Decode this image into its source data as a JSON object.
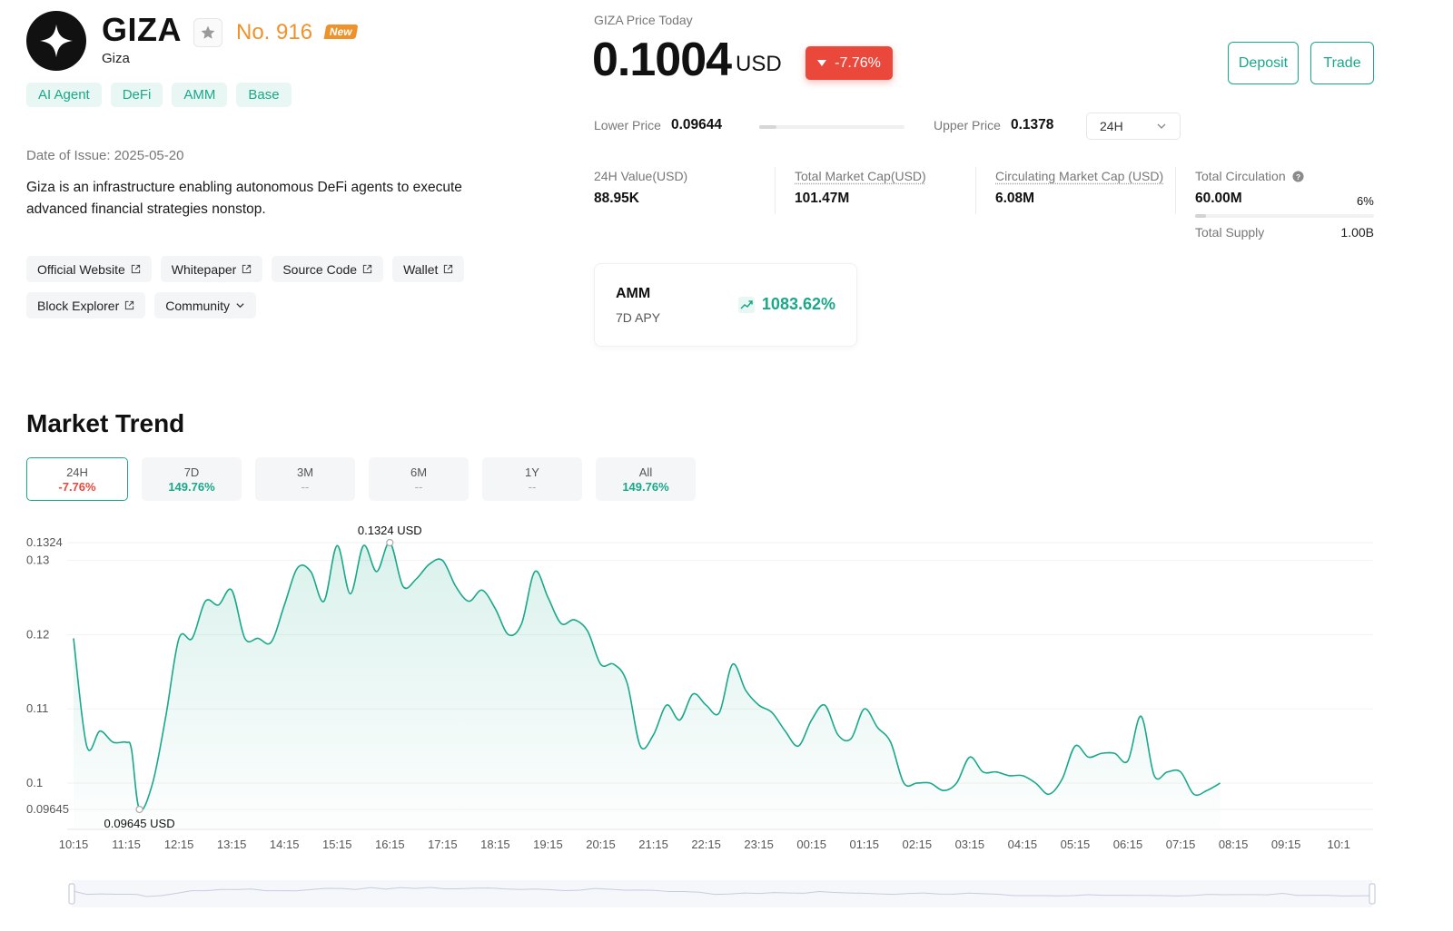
{
  "token": {
    "name": "GIZA",
    "subname": "Giza",
    "rank": "No. 916",
    "new_badge": "New",
    "tags": [
      "AI Agent",
      "DeFi",
      "AMM",
      "Base"
    ],
    "issue_date": "Date of Issue: 2025-05-20",
    "description": "Giza is an infrastructure enabling autonomous DeFi agents to execute advanced financial strategies nonstop.",
    "links": [
      {
        "label": "Official Website",
        "icon": "external-link-icon"
      },
      {
        "label": "Whitepaper",
        "icon": "external-link-icon"
      },
      {
        "label": "Source Code",
        "icon": "external-link-icon"
      },
      {
        "label": "Wallet",
        "icon": "external-link-icon"
      },
      {
        "label": "Block Explorer",
        "icon": "external-link-icon"
      },
      {
        "label": "Community",
        "icon": "chevron-down-icon"
      }
    ]
  },
  "price": {
    "label": "GIZA Price Today",
    "value": "0.1004",
    "unit": "USD",
    "change": "-7.76%",
    "lower_label": "Lower Price",
    "lower_value": "0.09644",
    "upper_label": "Upper Price",
    "upper_value": "0.1378",
    "period": "24H",
    "range_position": 0.12
  },
  "actions": {
    "deposit": "Deposit",
    "trade": "Trade"
  },
  "stats": {
    "value24h": {
      "label": "24H Value(USD)",
      "value": "88.95K"
    },
    "market_cap": {
      "label": "Total Market Cap(USD)",
      "value": "101.47M"
    },
    "circ_market_cap": {
      "label": "Circulating Market Cap (USD)",
      "value": "6.08M"
    },
    "total_circulation": {
      "label": "Total Circulation",
      "value": "60.00M",
      "percent": "6%"
    },
    "total_supply": {
      "label": "Total Supply",
      "value": "1.00B"
    }
  },
  "apy": {
    "name": "AMM",
    "sub": "7D APY",
    "value": "1083.62%"
  },
  "market": {
    "title": "Market Trend",
    "tabs": [
      {
        "label": "24H",
        "value": "-7.76%",
        "state": "neg",
        "active": true
      },
      {
        "label": "7D",
        "value": "149.76%",
        "state": "pos",
        "active": false
      },
      {
        "label": "3M",
        "value": "--",
        "state": "none",
        "active": false
      },
      {
        "label": "6M",
        "value": "--",
        "state": "none",
        "active": false
      },
      {
        "label": "1Y",
        "value": "--",
        "state": "none",
        "active": false
      },
      {
        "label": "All",
        "value": "149.76%",
        "state": "pos",
        "active": false
      }
    ]
  },
  "colors": {
    "accent": "#1aa88a",
    "negative": "#e9483b",
    "rank": "#f0922a"
  },
  "chart_data": {
    "type": "area",
    "x_ticks": [
      "10:15",
      "11:15",
      "12:15",
      "13:15",
      "14:15",
      "15:15",
      "16:15",
      "17:15",
      "18:15",
      "19:15",
      "20:15",
      "21:15",
      "22:15",
      "23:15",
      "00:15",
      "01:15",
      "02:15",
      "03:15",
      "04:15",
      "05:15",
      "06:15",
      "07:15",
      "08:15",
      "09:15",
      "10:1"
    ],
    "y_ticks": [
      0.1324,
      0.13,
      0.12,
      0.11,
      0.1,
      0.09645
    ],
    "y_tick_labels": [
      "0.1324",
      "0.13",
      "0.12",
      "0.11",
      "0.1",
      "0.09645"
    ],
    "ylim": [
      0.09645,
      0.1324
    ],
    "max_label": "0.1324 USD",
    "min_label": "0.09645 USD",
    "max_point": {
      "x": 6.0,
      "y": 0.1324
    },
    "min_point": {
      "x": 1.25,
      "y": 0.09645
    },
    "series": [
      {
        "values": [
          [
            0.0,
            0.1195
          ],
          [
            0.25,
            0.105
          ],
          [
            0.5,
            0.107
          ],
          [
            0.75,
            0.1055
          ],
          [
            1.0,
            0.1055
          ],
          [
            1.1,
            0.1045
          ],
          [
            1.25,
            0.09645
          ],
          [
            1.5,
            0.1
          ],
          [
            1.75,
            0.109
          ],
          [
            2.0,
            0.1195
          ],
          [
            2.25,
            0.1195
          ],
          [
            2.5,
            0.1245
          ],
          [
            2.75,
            0.124
          ],
          [
            3.0,
            0.126
          ],
          [
            3.25,
            0.1195
          ],
          [
            3.5,
            0.1195
          ],
          [
            3.75,
            0.119
          ],
          [
            4.0,
            0.124
          ],
          [
            4.25,
            0.129
          ],
          [
            4.5,
            0.1285
          ],
          [
            4.75,
            0.1245
          ],
          [
            5.0,
            0.132
          ],
          [
            5.25,
            0.1255
          ],
          [
            5.5,
            0.132
          ],
          [
            5.75,
            0.1285
          ],
          [
            6.0,
            0.1324
          ],
          [
            6.25,
            0.1265
          ],
          [
            6.5,
            0.1275
          ],
          [
            6.75,
            0.1295
          ],
          [
            7.0,
            0.13
          ],
          [
            7.25,
            0.1265
          ],
          [
            7.5,
            0.1245
          ],
          [
            7.75,
            0.126
          ],
          [
            8.0,
            0.1235
          ],
          [
            8.25,
            0.12
          ],
          [
            8.5,
            0.1215
          ],
          [
            8.75,
            0.1285
          ],
          [
            9.0,
            0.125
          ],
          [
            9.25,
            0.1215
          ],
          [
            9.5,
            0.122
          ],
          [
            9.75,
            0.1205
          ],
          [
            10.0,
            0.116
          ],
          [
            10.25,
            0.116
          ],
          [
            10.5,
            0.1135
          ],
          [
            10.75,
            0.105
          ],
          [
            11.0,
            0.1065
          ],
          [
            11.25,
            0.1105
          ],
          [
            11.5,
            0.1085
          ],
          [
            11.75,
            0.112
          ],
          [
            12.0,
            0.1105
          ],
          [
            12.25,
            0.1095
          ],
          [
            12.5,
            0.116
          ],
          [
            12.75,
            0.1125
          ],
          [
            13.0,
            0.1105
          ],
          [
            13.25,
            0.1095
          ],
          [
            13.5,
            0.107
          ],
          [
            13.75,
            0.105
          ],
          [
            14.0,
            0.1085
          ],
          [
            14.25,
            0.1105
          ],
          [
            14.5,
            0.1065
          ],
          [
            14.75,
            0.106
          ],
          [
            15.0,
            0.11
          ],
          [
            15.25,
            0.1075
          ],
          [
            15.5,
            0.1055
          ],
          [
            15.75,
            0.1
          ],
          [
            16.0,
            0.1
          ],
          [
            16.25,
            0.1
          ],
          [
            16.5,
            0.099
          ],
          [
            16.75,
            0.1
          ],
          [
            17.0,
            0.1035
          ],
          [
            17.25,
            0.1015
          ],
          [
            17.5,
            0.1015
          ],
          [
            17.75,
            0.101
          ],
          [
            18.0,
            0.101
          ],
          [
            18.25,
            0.1
          ],
          [
            18.5,
            0.0985
          ],
          [
            18.75,
            0.1005
          ],
          [
            19.0,
            0.105
          ],
          [
            19.25,
            0.1035
          ],
          [
            19.5,
            0.104
          ],
          [
            19.75,
            0.104
          ],
          [
            20.0,
            0.103
          ],
          [
            20.25,
            0.109
          ],
          [
            20.5,
            0.101
          ],
          [
            20.75,
            0.1015
          ],
          [
            21.0,
            0.1015
          ],
          [
            21.25,
            0.0985
          ],
          [
            21.5,
            0.099
          ],
          [
            21.75,
            0.1
          ]
        ]
      }
    ]
  }
}
